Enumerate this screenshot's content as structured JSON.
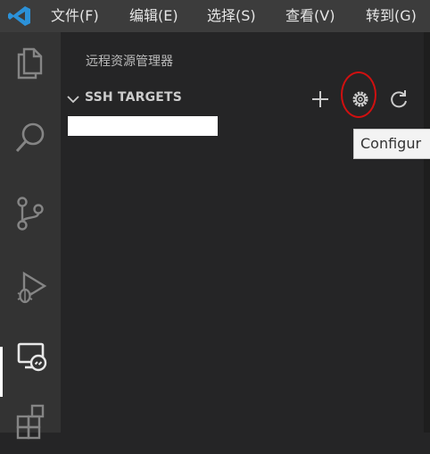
{
  "menubar": {
    "items": [
      "文件(F)",
      "编辑(E)",
      "选择(S)",
      "查看(V)",
      "转到(G)"
    ]
  },
  "activitybar": {
    "icons": [
      "explorer-icon",
      "search-icon",
      "source-control-icon",
      "run-debug-icon",
      "remote-explorer-icon",
      "extensions-icon"
    ],
    "active": "remote-explorer-icon"
  },
  "sidebar": {
    "title": "远程资源管理器",
    "section": {
      "label": "SSH TARGETS",
      "expanded": true,
      "actions": [
        "add-icon",
        "gear-icon",
        "refresh-icon"
      ]
    },
    "target": {
      "redacted": true
    }
  },
  "tooltip": {
    "text": "Configur"
  },
  "colors": {
    "menubar": "#3c3c3c",
    "activitybar": "#333333",
    "sidebar": "#252526",
    "logo": "#2b91d8",
    "annotation": "#d01010"
  }
}
